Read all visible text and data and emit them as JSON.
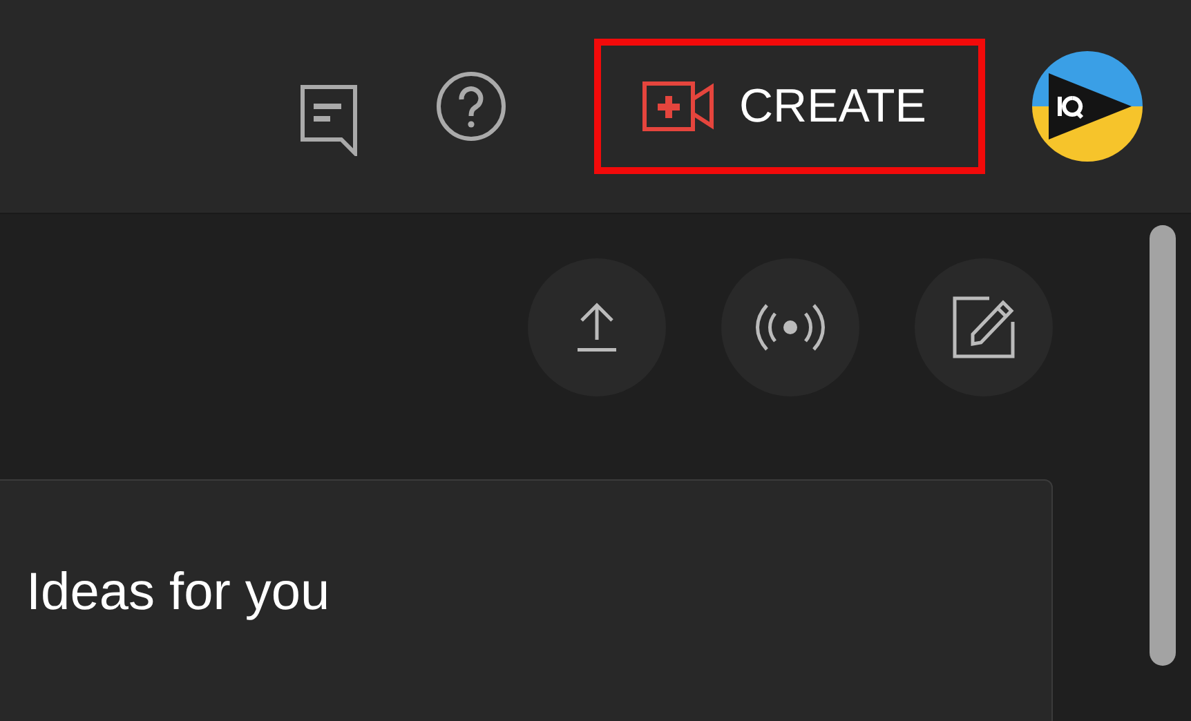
{
  "header": {
    "create_button": {
      "label": "CREATE",
      "highlighted": true
    }
  },
  "page": {
    "card": {
      "title": "Ideas for you"
    }
  }
}
